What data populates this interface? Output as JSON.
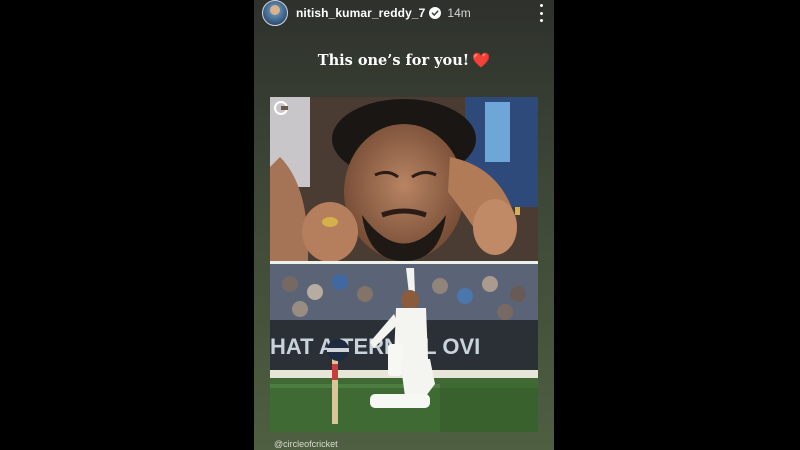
{
  "story": {
    "username": "nitish_kumar_reddy_7",
    "time_ago": "14m",
    "caption": "This one’s for you!",
    "caption_emoji": "❤️",
    "banner_text": "HAT A TERNIGL  OVI",
    "credit": "@circleofcricket"
  }
}
